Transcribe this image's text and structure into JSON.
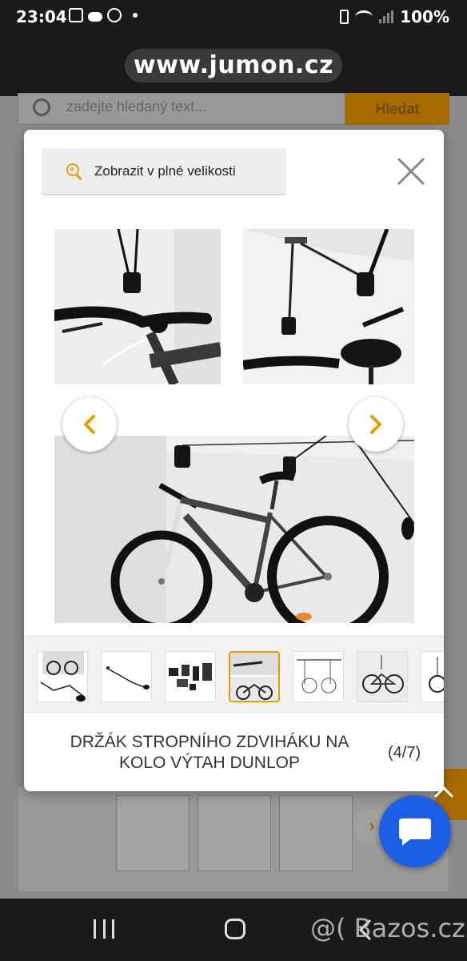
{
  "status_bar": {
    "time": "23:04",
    "battery": "100%"
  },
  "browser": {
    "url": "www.jumon.cz"
  },
  "background_page": {
    "search_placeholder": "zadejte hledaný text...",
    "search_button": "Hledat"
  },
  "modal": {
    "fullsize_label": "Zobrazit v plné velikosti",
    "title_line1": "DRŽÁK STROPNÍHO ZDVIHÁKU NA",
    "title_line2": "KOLO VÝTAH DUNLOP",
    "counter": "(4/7)"
  },
  "thumbnails": [
    "thumb-1",
    "thumb-2",
    "thumb-3",
    "thumb-4",
    "thumb-5",
    "thumb-6",
    "thumb-7"
  ],
  "active_thumbnail_index": 4,
  "watermark": "@( Bazos.cz",
  "colors": {
    "accent": "#e0a000",
    "chat": "#1b5fe6"
  }
}
